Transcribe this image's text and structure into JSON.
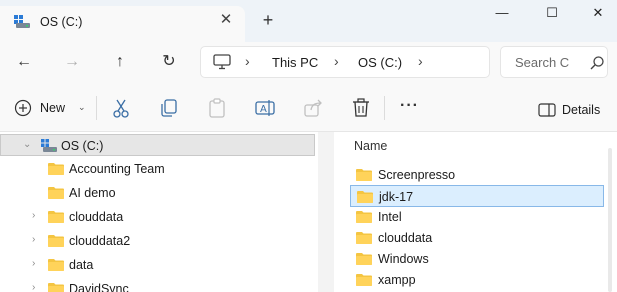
{
  "window": {
    "tab_title": "OS (C:)",
    "close_tab_glyph": "✕",
    "new_tab_glyph": "+",
    "minimize_glyph": "—",
    "maximize_glyph": "☐",
    "close_glyph": "✕"
  },
  "nav": {
    "back_glyph": "←",
    "forward_glyph": "→",
    "up_glyph": "↑",
    "refresh_glyph": "↻",
    "breadcrumb": [
      "This PC",
      "OS (C:)"
    ],
    "sep_glyph": "›",
    "search_placeholder": "Search C"
  },
  "toolbar": {
    "new_label": "New",
    "new_chevron": "⌄",
    "more_glyph": "···",
    "details_label": "Details",
    "icons": [
      "plus-circle-icon",
      "cut-icon",
      "copy-icon",
      "paste-icon",
      "rename-icon",
      "share-icon",
      "delete-icon",
      "more-icon",
      "details-pane-icon"
    ]
  },
  "tree": {
    "root_label": "OS (C:)",
    "items": [
      {
        "label": "Accounting Team",
        "has_children": false
      },
      {
        "label": "AI demo",
        "has_children": false
      },
      {
        "label": "clouddata",
        "has_children": true
      },
      {
        "label": "clouddata2",
        "has_children": true
      },
      {
        "label": "data",
        "has_children": true
      },
      {
        "label": "DavidSync",
        "has_children": true
      }
    ],
    "expanded_glyph": "⌄",
    "collapsed_glyph": "›"
  },
  "files": {
    "column_name": "Name",
    "items": [
      {
        "name": "Screenpresso",
        "selected": false
      },
      {
        "name": "jdk-17",
        "selected": true
      },
      {
        "name": "Intel",
        "selected": false
      },
      {
        "name": "clouddata",
        "selected": false
      },
      {
        "name": "Windows",
        "selected": false
      },
      {
        "name": "xampp",
        "selected": false
      }
    ]
  },
  "colors": {
    "folder": "#f4c542",
    "selection_blue": "#dbeefe",
    "selection_border": "#88b8e8"
  }
}
